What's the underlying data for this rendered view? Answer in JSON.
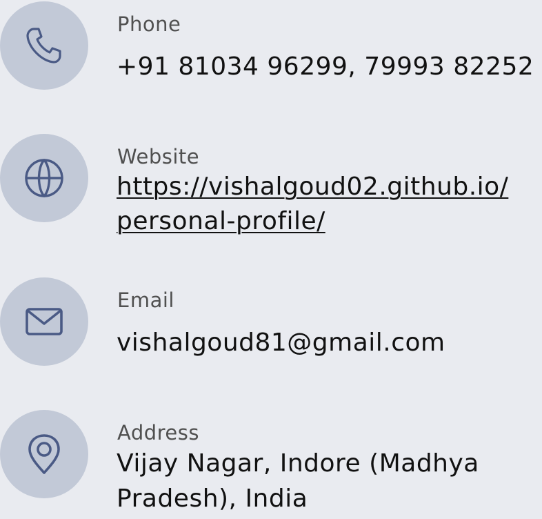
{
  "contacts": {
    "phone": {
      "label": "Phone",
      "value": "+91 81034 96299, 79993 82252",
      "icon": "phone-icon"
    },
    "website": {
      "label": "Website",
      "value_line1": "https://vishalgoud02.github.io/",
      "value_line2": "personal-profile/",
      "icon": "globe-icon"
    },
    "email": {
      "label": "Email",
      "value": "vishalgoud81@gmail.com",
      "icon": "mail-icon"
    },
    "address": {
      "label": "Address",
      "value_line1": "Vijay Nagar, Indore (Madhya",
      "value_line2": "Pradesh), India",
      "icon": "location-pin-icon"
    }
  },
  "colors": {
    "background": "#e9ebf0",
    "icon_circle": "#c2c9d7",
    "icon_stroke": "#4a5a85",
    "label_text": "#505050",
    "value_text": "#111111"
  }
}
